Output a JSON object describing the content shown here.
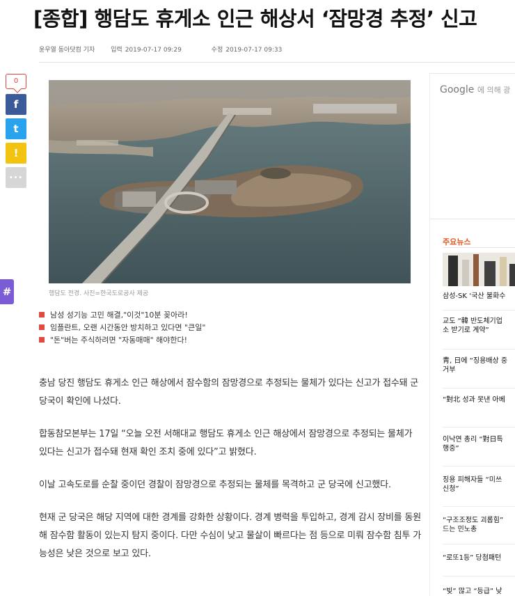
{
  "article": {
    "headline": "[종합] 행담도 휴게소 인근 해상서 ‘잠망경 추정’ 신고",
    "reporter": "윤우열 동아닷컴 기자",
    "published_label": "입력",
    "published": "2019-07-17 09:29",
    "modified_label": "수정",
    "modified": "2019-07-17 09:33",
    "photo_caption": "행담도 전경. 사진=한국도로공사 제공",
    "paragraphs": [
      "충남 당진 행담도 휴게소 인근 해상에서 잠수함의 잠망경으로 추정되는 물체가 있다는 신고가 접수돼 군 당국이 확인에 나섰다.",
      "합동참모본부는 17일 “오늘 오전 서해대교 행담도 휴게소 인근 해상에서 잠망경으로 추정되는 물체가 있다는 신고가 접수돼 현재 확인 조치 중에 있다”고 밝혔다.",
      "이날 고속도로를 순찰 중이던 경찰이 잠망경으로 추정되는 물체를 목격하고 군 당국에 신고했다.",
      "현재 군 당국은 해당 지역에 대한 경계를 강화한 상황이다. 경계 병력을 투입하고, 경계 감시 장비를 동원해 잠수함 활동이 있는지 탐지 중이다. 다만 수심이 낮고 물살이 빠르다는 점 등으로 미뤄 잠수함 침투 가능성은 낮은 것으로 보고 있다."
    ]
  },
  "share": {
    "count": "0",
    "facebook_glyph": "f",
    "twitter_glyph": "t",
    "kakaostory_glyph": "!",
    "more_glyph": "···",
    "hashtag_glyph": "#"
  },
  "related_links": [
    "남성 성기능 고민 해결,\"이것\"10분 꽂아라!",
    "임플란트, 오랜 시간동안 방치하고 있다면 \"큰일\"",
    "\"돈\"버는 주식하려면 \"자동매매\" 해야한다!"
  ],
  "sidebar": {
    "ad_brand": "Google",
    "ad_suffix": "에 의해 광",
    "news_title": "주요뉴스",
    "news_items": [
      {
        "line1": "삼성-SK ‘국산 불화수",
        "line2": ""
      },
      {
        "line1": "교도 “韓 반도체기업",
        "line2": "소 받기로 계약”"
      },
      {
        "line1": "靑, 日에 “징용배상 중",
        "line2": "거부"
      },
      {
        "line1": "“對北 성과 못낸 아베",
        "line2": ""
      },
      {
        "line1": "이낙연 총리 “對日특",
        "line2": "행중”"
      },
      {
        "line1": "징용 피해자들 “미쓰",
        "line2": "신청”"
      },
      {
        "line1": "“구조조정도 괴롭힘”",
        "line2": "드는 민노총"
      },
      {
        "line1": "“로또1등” 당첨패턴",
        "line2": ""
      },
      {
        "line1": "“빚” 많고 “등급” 낮",
        "line2": ""
      }
    ]
  },
  "colors": {
    "facebook": "#3b5a9a",
    "twitter": "#2aa3ef",
    "kakaostory": "#f2c311",
    "accent_red": "#e04a3f",
    "news_title": "#e2551e",
    "hashtag": "#7b5bd6"
  }
}
